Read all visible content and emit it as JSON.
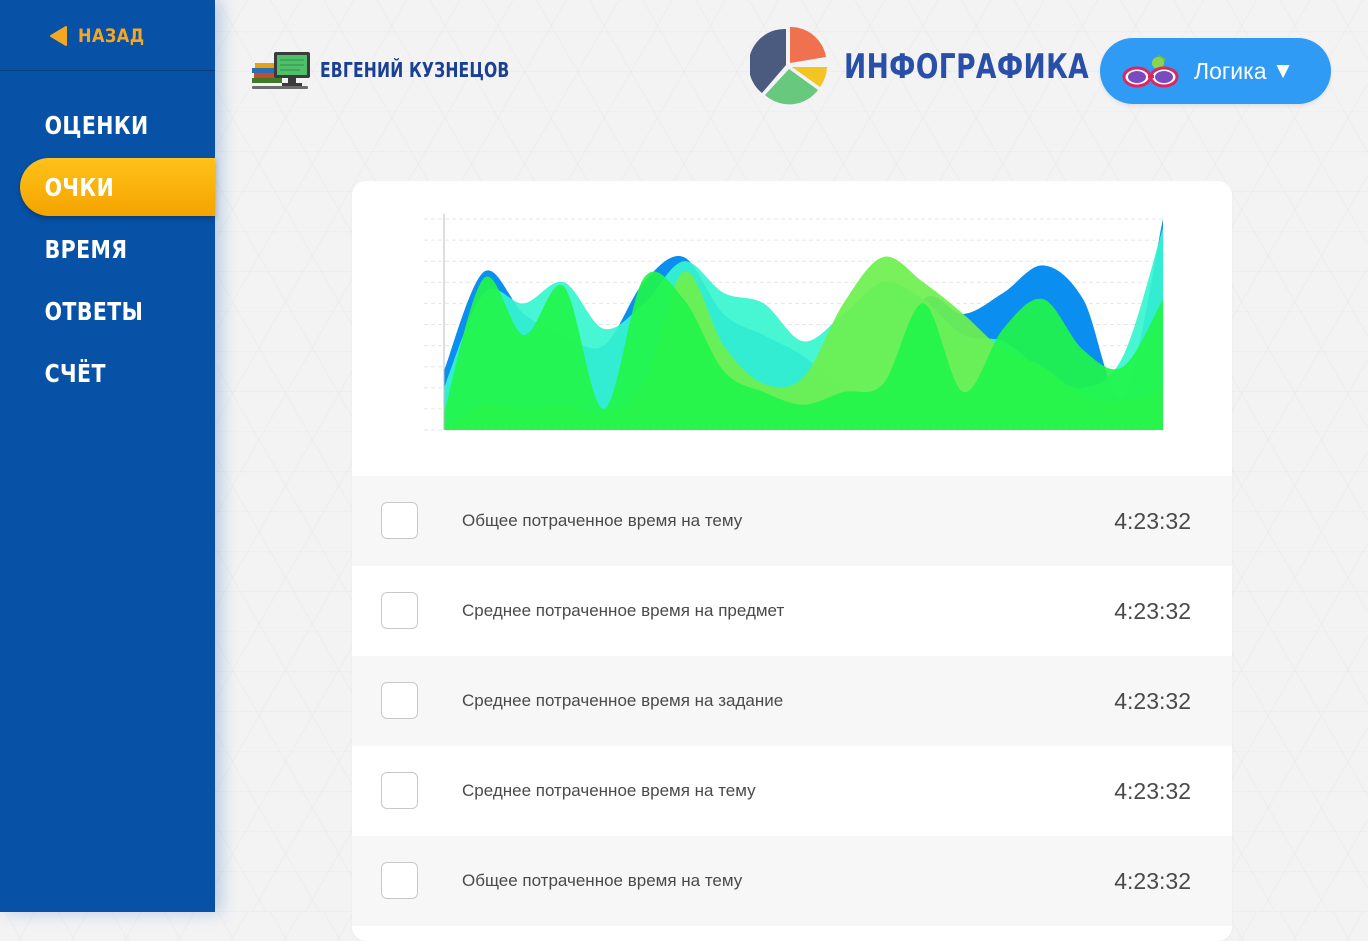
{
  "sidebar": {
    "back_label": "НАЗАД",
    "items": [
      {
        "label": "ОЦЕНКИ",
        "active": false
      },
      {
        "label": "ОЧКИ",
        "active": true
      },
      {
        "label": "ВРЕМЯ",
        "active": false
      },
      {
        "label": "ОТВЕТЫ",
        "active": false
      },
      {
        "label": "СЧЁТ",
        "active": false
      }
    ]
  },
  "header": {
    "user_name": "ЕВГЕНИЙ КУЗНЕЦОВ",
    "brand_title": "ИНФОГРАФИКА",
    "subject_label": "Логика",
    "subject_caret": "▼"
  },
  "colors": {
    "sidebar": "#0752a6",
    "active_item": "#ffc21a",
    "back_accent": "#f5a623",
    "subject_button": "#2f9bf5",
    "brand_text": "#2a4fa8",
    "series_blue": "#0a8ef0",
    "series_cyan": "#37f5cf",
    "series_lightgreen": "#6ef04e",
    "series_green": "#22f54a"
  },
  "icons": {
    "back": "triangle-left-icon",
    "user": "computer-books-icon",
    "brand": "pie-chart-logo-icon",
    "subject": "glasses-icon"
  },
  "stats": [
    {
      "label": "Общее потраченное время на тему",
      "value": "4:23:32"
    },
    {
      "label": "Среднее потраченное время на предмет",
      "value": "4:23:32"
    },
    {
      "label": "Среднее потраченное время на задание",
      "value": "4:23:32"
    },
    {
      "label": "Среднее потраченное время на тему",
      "value": "4:23:32"
    },
    {
      "label": "Общее потраченное время на тему",
      "value": "4:23:32"
    }
  ],
  "chart_data": {
    "type": "area",
    "title": "",
    "xlabel": "",
    "ylabel": "",
    "x": [
      0,
      1,
      2,
      3,
      4,
      5,
      6,
      7,
      8,
      9,
      10,
      11,
      12,
      13,
      14,
      15,
      16,
      17,
      18
    ],
    "ylim": [
      0,
      100
    ],
    "grid": true,
    "series": [
      {
        "values": [
          28,
          75,
          55,
          45,
          40,
          70,
          82,
          55,
          45,
          35,
          20,
          18,
          62,
          55,
          65,
          78,
          62,
          16,
          100
        ],
        "color": "#0a8ef0"
      },
      {
        "values": [
          20,
          65,
          60,
          70,
          48,
          60,
          80,
          65,
          60,
          42,
          55,
          70,
          62,
          45,
          42,
          28,
          20,
          35,
          96
        ],
        "color": "#37f5cf"
      },
      {
        "values": [
          0,
          12,
          10,
          12,
          8,
          22,
          75,
          40,
          22,
          25,
          60,
          82,
          70,
          55,
          38,
          30,
          16,
          14,
          20
        ],
        "color": "#6ef04e"
      },
      {
        "values": [
          8,
          72,
          45,
          68,
          10,
          72,
          62,
          28,
          18,
          12,
          18,
          22,
          60,
          18,
          48,
          62,
          38,
          30,
          62
        ],
        "color": "#22f54a"
      }
    ]
  }
}
